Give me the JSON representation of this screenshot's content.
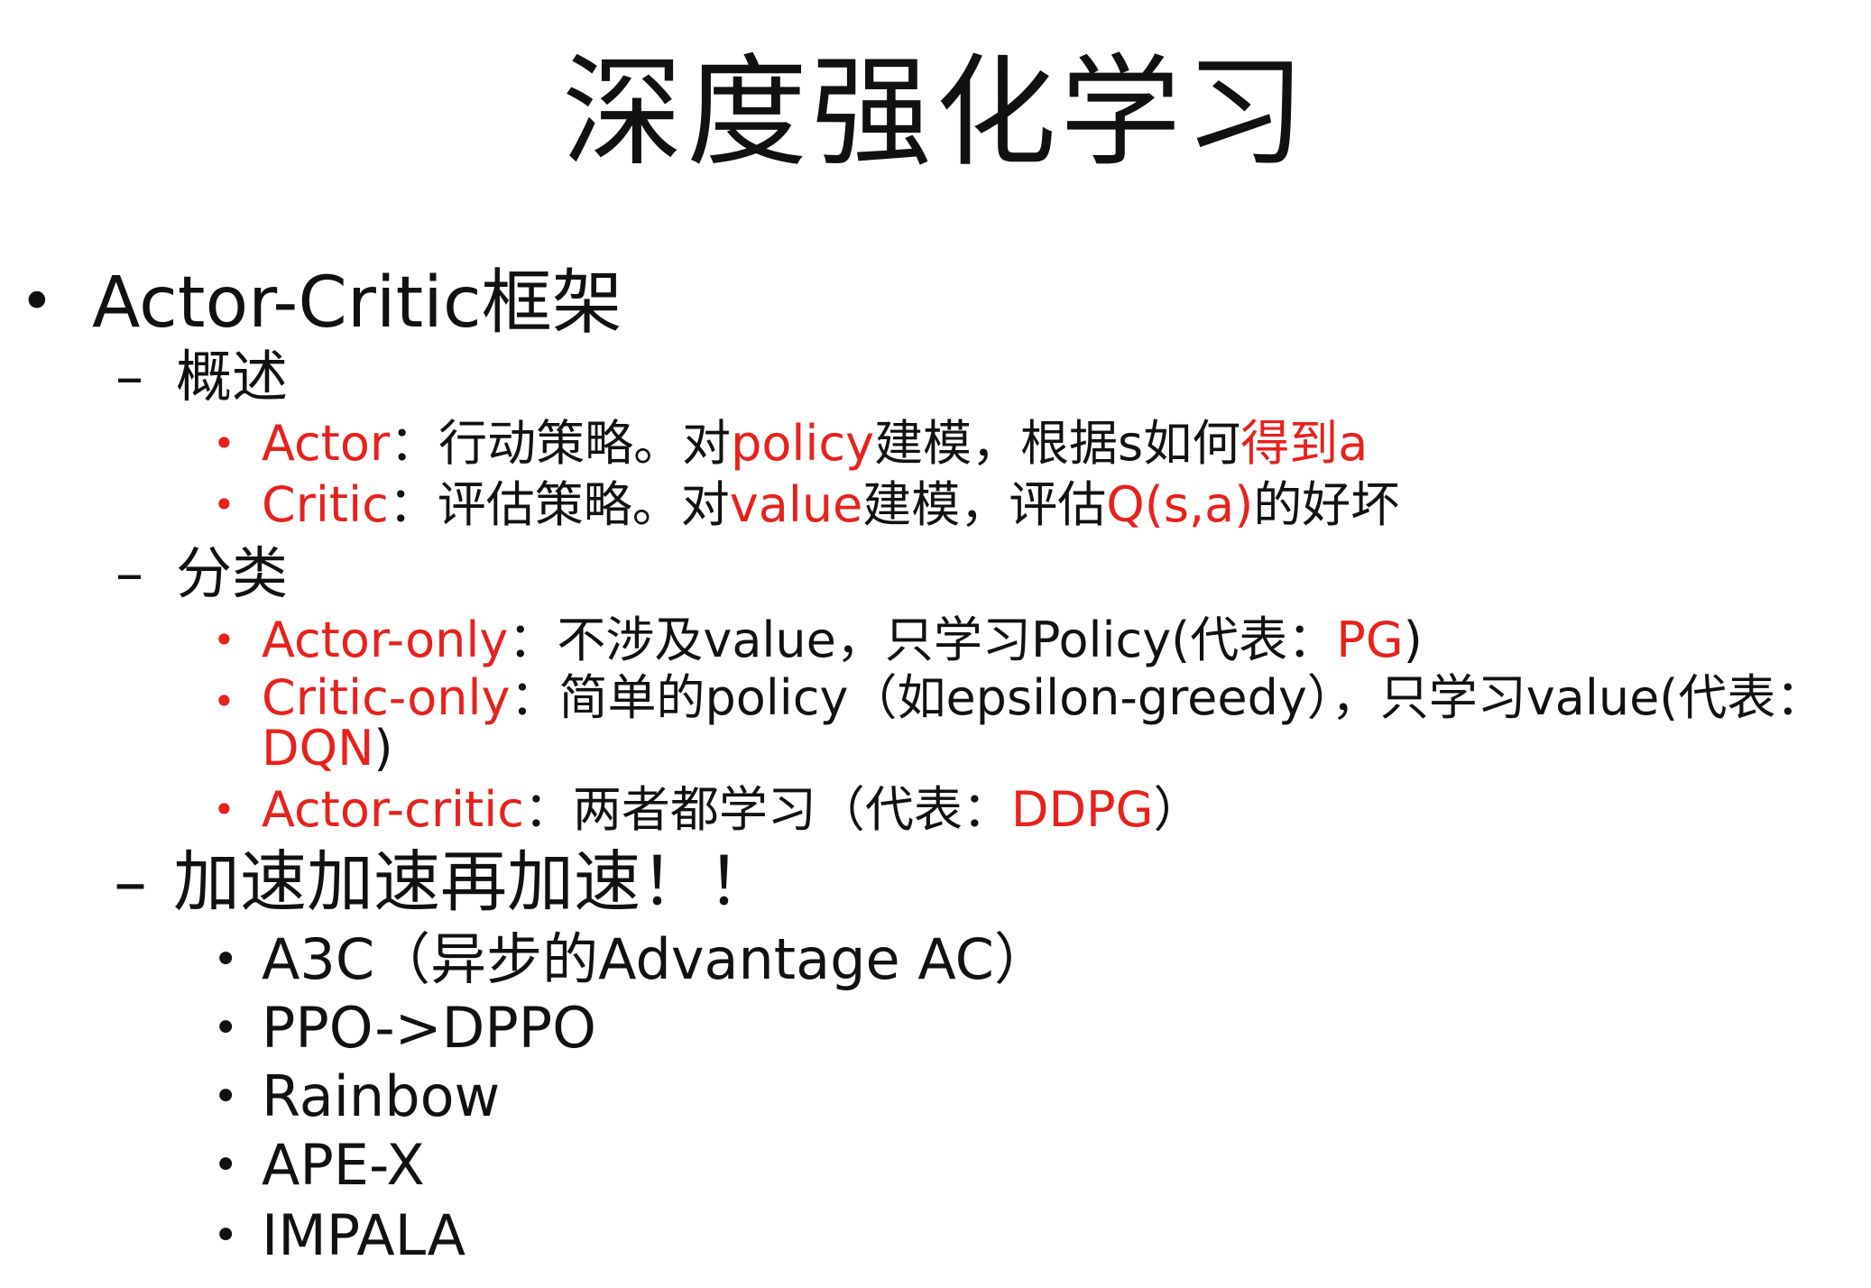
{
  "title": "深度强化学习",
  "bullets": {
    "dot": "•",
    "dash": "–"
  },
  "section": {
    "heading": "Actor-Critic框架",
    "overview": {
      "label": "概述",
      "items": [
        {
          "term": "Actor",
          "text1": "：行动策略。对",
          "hl1": "policy",
          "text2": "建模，根据s如何",
          "hl2": "得到a"
        },
        {
          "term": "Critic",
          "text1": "：评估策略。对",
          "hl1": "value",
          "text2": "建模，评估",
          "hl2": "Q(s,a)",
          "text3": "的好坏"
        }
      ]
    },
    "classification": {
      "label": "分类",
      "items": [
        {
          "term": "Actor-only",
          "text1": "：不涉及value，只学习Policy(代表：",
          "hl1": "PG",
          "text2": ")"
        },
        {
          "term": "Critic-only",
          "text1": "：简单的policy（如epsilon-greedy），只学习value(代表：",
          "hl1": "DQN",
          "text2": ")"
        },
        {
          "term": "Actor-critic",
          "text1": "：两者都学习（代表：",
          "hl1": "DDPG",
          "text2": "）"
        }
      ]
    },
    "speedup": {
      "label": "加速加速再加速！！",
      "items": [
        "A3C（异步的Advantage AC）",
        "PPO->DPPO",
        "Rainbow",
        "APE-X",
        "IMPALA"
      ]
    }
  },
  "colors": {
    "highlight": "#e8211d",
    "text": "#111111",
    "background": "#ffffff"
  }
}
